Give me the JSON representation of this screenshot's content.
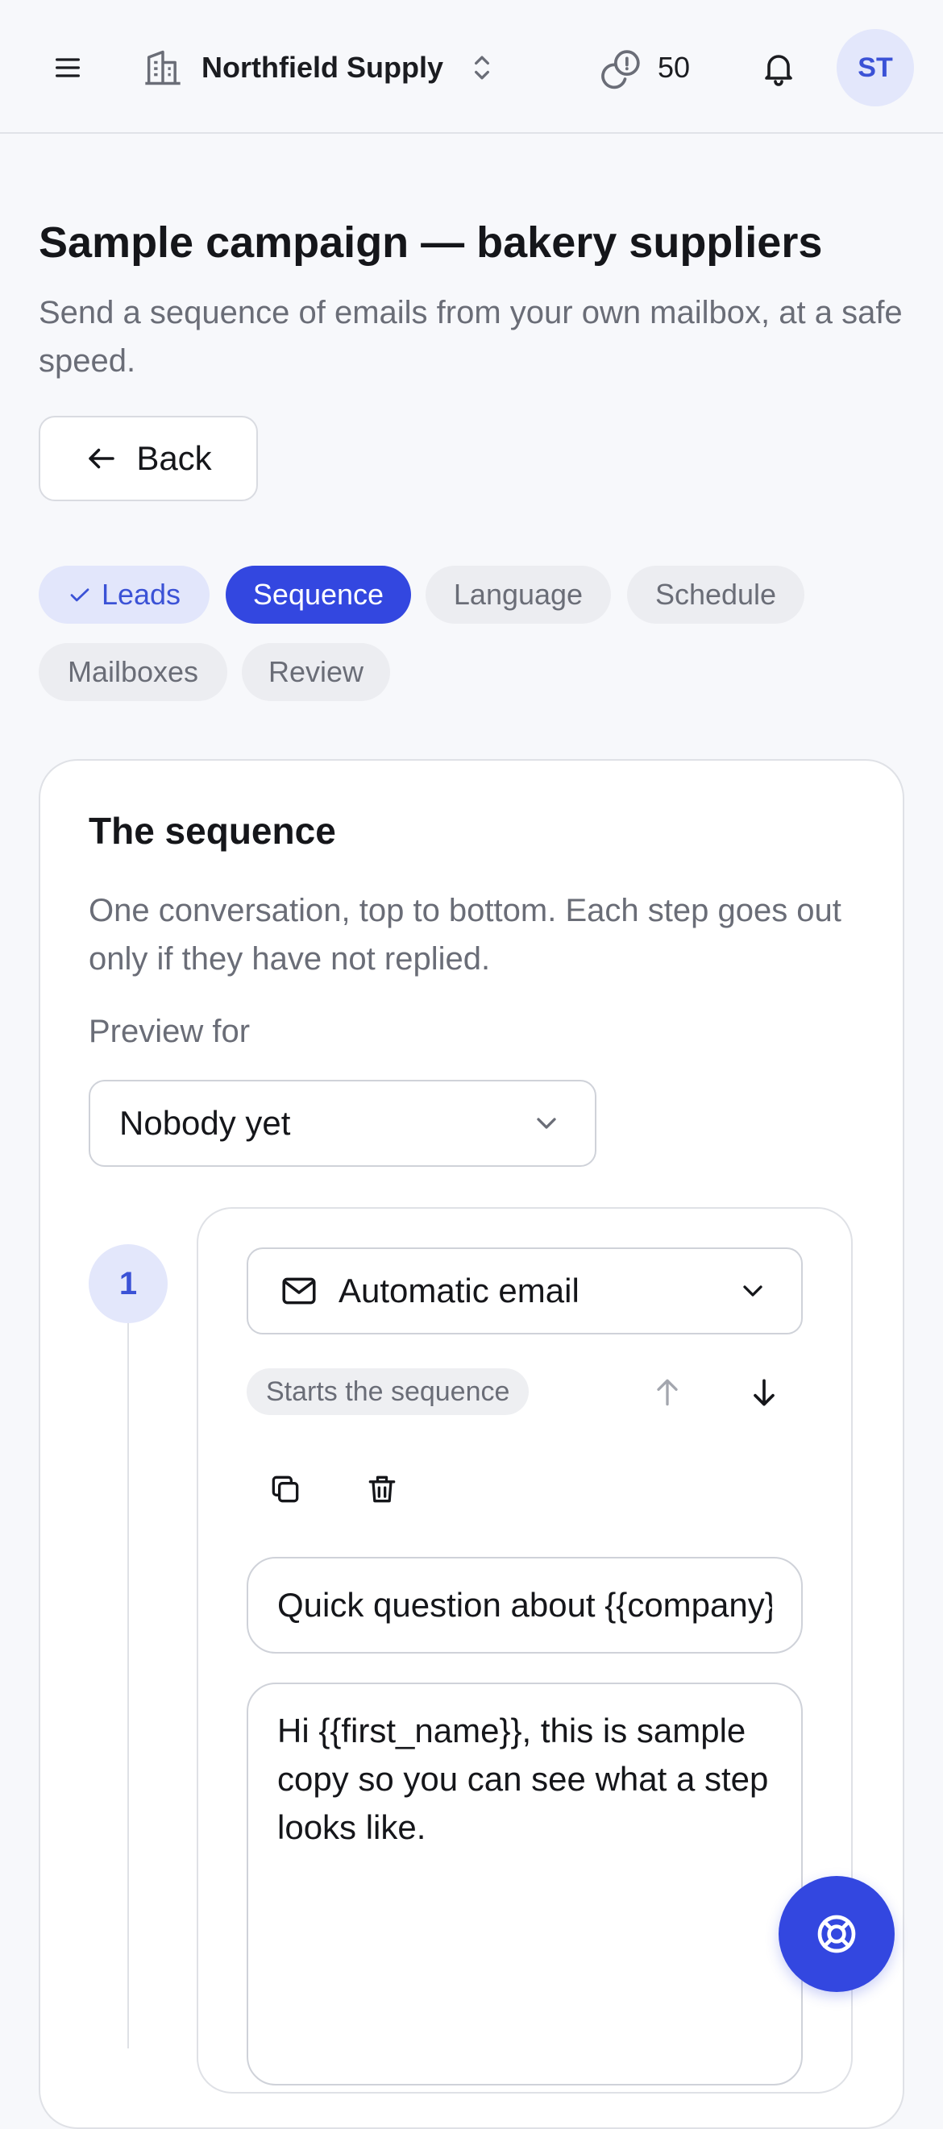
{
  "topbar": {
    "org_name": "Northfield Supply",
    "credits": "50",
    "avatar_initials": "ST"
  },
  "header": {
    "title": "Sample campaign — bakery suppliers",
    "subtitle": "Send a sequence of emails from your own mailbox, at a safe speed.",
    "back_label": "Back"
  },
  "tabs": [
    {
      "label": "Leads",
      "state": "done"
    },
    {
      "label": "Sequence",
      "state": "active"
    },
    {
      "label": "Language",
      "state": "todo"
    },
    {
      "label": "Schedule",
      "state": "todo"
    },
    {
      "label": "Mailboxes",
      "state": "todo"
    },
    {
      "label": "Review",
      "state": "todo"
    }
  ],
  "sequence": {
    "title": "The sequence",
    "description": "One conversation, top to bottom. Each step goes out only if they have not replied.",
    "preview_label": "Preview for",
    "preview_value": "Nobody yet",
    "steps": [
      {
        "number": "1",
        "type": "Automatic email",
        "badge": "Starts the sequence",
        "subject": "Quick question about {{company}}",
        "body": "Hi {{first_name}}, this is sample copy so you can see what a step looks like."
      }
    ]
  },
  "colors": {
    "accent": "#3347e0",
    "accent_soft": "#e3e7fb",
    "text_muted": "#6a6d77",
    "border": "#dfe1e6"
  },
  "icons": {
    "menu": "hamburger-menu-icon",
    "org": "building-icon",
    "org_switch": "chevron-up-down-icon",
    "credits": "coins-icon",
    "notifications": "bell-icon",
    "back": "arrow-left-icon",
    "done": "check-icon",
    "select": "chevron-down-icon",
    "email": "mail-icon",
    "move_up": "arrow-up-icon",
    "move_down": "arrow-down-icon",
    "duplicate": "copy-icon",
    "delete": "trash-icon",
    "help": "lifebuoy-icon"
  }
}
